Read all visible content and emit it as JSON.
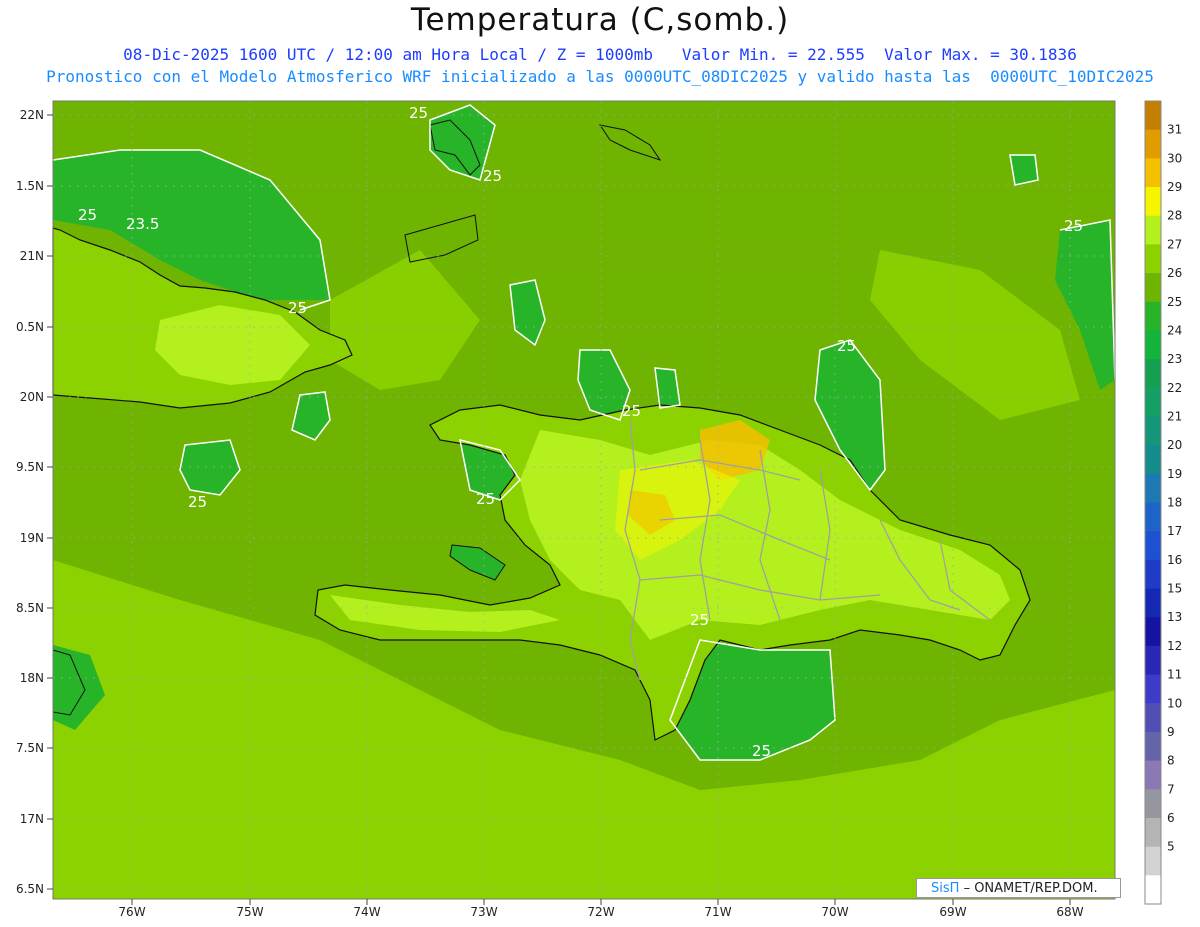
{
  "header": {
    "title": "Temperatura (C,somb.)",
    "line1": "08-Dic-2025 1600 UTC / 12:00 am Hora Local / Z = 1000mb   Valor Min. = 22.555  Valor Max. = 30.1836",
    "line2": "Pronostico con el Modelo Atmosferico WRF inicializado a las 0000UTC_08DIC2025 y valido hasta las  0000UTC_10DIC2025"
  },
  "axes": {
    "lat_labels": [
      "22N",
      "1.5N",
      "21N",
      "0.5N",
      "20N",
      "9.5N",
      "19N",
      "8.5N",
      "18N",
      "7.5N",
      "17N",
      "6.5N"
    ],
    "lon_labels": [
      "76W",
      "75W",
      "74W",
      "73W",
      "72W",
      "71W",
      "70W",
      "69W",
      "68W"
    ]
  },
  "contour_labels": [
    {
      "text": "25"
    },
    {
      "text": "25"
    },
    {
      "text": "25"
    },
    {
      "text": "23.5"
    },
    {
      "text": "25"
    },
    {
      "text": "25"
    },
    {
      "text": "25"
    },
    {
      "text": "25"
    },
    {
      "text": "25"
    },
    {
      "text": "25"
    },
    {
      "text": "25"
    },
    {
      "text": "25"
    }
  ],
  "colorbar": {
    "labels": [
      "31",
      "30",
      "29",
      "28",
      "27",
      "26",
      "25",
      "24",
      "23",
      "22",
      "21",
      "20",
      "19",
      "18",
      "17",
      "16",
      "15",
      "13",
      "12",
      "11",
      "10",
      "9",
      "8",
      "7",
      "6",
      "5"
    ],
    "colors": [
      "#c27f00",
      "#e09c00",
      "#f5c000",
      "#f5f500",
      "#b4f01e",
      "#8cd200",
      "#6eb400",
      "#28b428",
      "#14b43c",
      "#14a050",
      "#14a064",
      "#149678",
      "#148c8c",
      "#1e78b4",
      "#1e64c8",
      "#1e50d2",
      "#1e3cc8",
      "#1428b4",
      "#1414a0",
      "#2828b4",
      "#3c3cc8",
      "#5050b4",
      "#6464aa",
      "#8c78b4",
      "#9696a0",
      "#b4b4b4",
      "#d2d2d2",
      "#ffffff"
    ]
  },
  "credit": {
    "logo": "SisΠ",
    "text": "– ONAMET/REP.DOM."
  }
}
